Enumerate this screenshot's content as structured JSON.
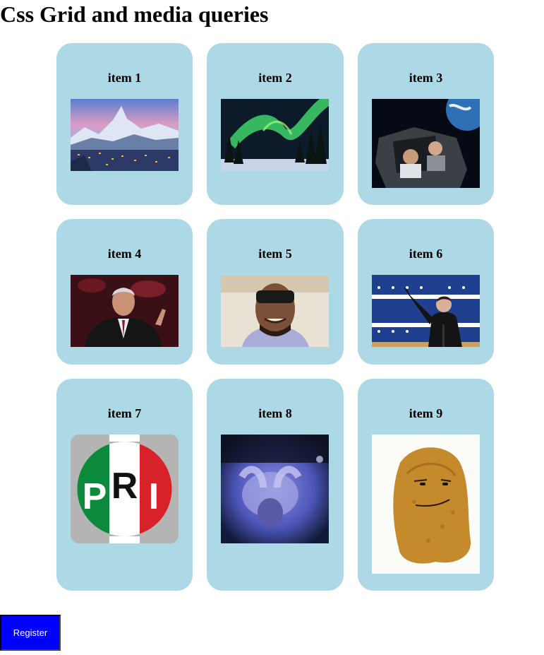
{
  "page": {
    "title": "Css Grid and media queries"
  },
  "items": [
    {
      "label": "item 1",
      "image": "snowy-mountain-village-photo"
    },
    {
      "label": "item 2",
      "image": "aurora-borealis-forest-photo"
    },
    {
      "label": "item 3",
      "image": "men-in-car-in-space-photo"
    },
    {
      "label": "item 4",
      "image": "man-in-suit-speaking-photo"
    },
    {
      "label": "item 5",
      "image": "man-in-sunglasses-selfie-photo"
    },
    {
      "label": "item 6",
      "image": "man-gesturing-at-podium-photo"
    },
    {
      "label": "item 7",
      "image": "pri-party-logo",
      "logo_text": "PRI"
    },
    {
      "label": "item 8",
      "image": "blurry-monkey-photo"
    },
    {
      "label": "item 9",
      "image": "chicken-nugget-face-photo"
    }
  ],
  "register_button": {
    "label": "Register"
  },
  "colors": {
    "card_background": "#add8e6",
    "button_background": "#0000ff",
    "button_text": "#ffffff"
  }
}
